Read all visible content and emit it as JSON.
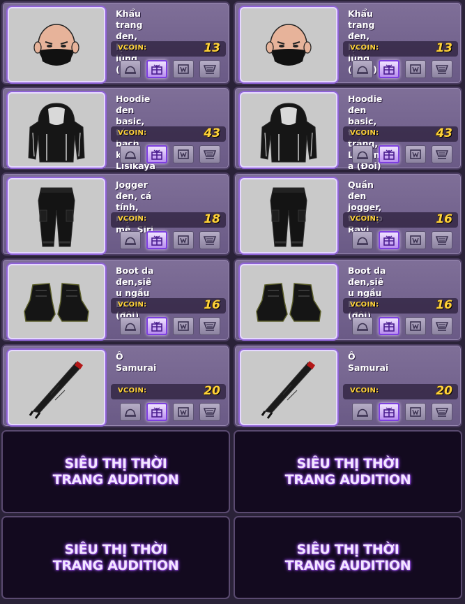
{
  "currency_label": "VCOIN:",
  "items": [
    {
      "name": "Khẩu trang đen, lạnh lùng (nữ)",
      "price": "13",
      "image": "mask-head-icon"
    },
    {
      "name": "Khẩu trang đen, lạnh lùng (nam)",
      "price": "13",
      "image": "mask-head-icon"
    },
    {
      "name": "Hoodie đen basic, tóc bạch kim Lisikaya (Đôi)",
      "price": "43",
      "image": "hoodie-icon"
    },
    {
      "name": "Hoodie đen basic, tóc trắng, Lisilanka (Đôi)",
      "price": "43",
      "image": "hoodie-icon"
    },
    {
      "name": "Jogger đen, cá tính, mạnh mẽ, Siri",
      "price": "18",
      "image": "jogger-pants-icon"
    },
    {
      "name": "Quần đen jogger, túi đắp Ravi",
      "price": "16",
      "image": "jogger-pants-icon"
    },
    {
      "name": "Boot da đen,siêu ngầu Brian (đôi)",
      "price": "16",
      "image": "boots-icon"
    },
    {
      "name": "Boot da đen,siêu ngầu Brian (đôi)",
      "price": "16",
      "image": "boots-icon"
    },
    {
      "name": "Ô Samurai",
      "price": "20",
      "image": "samurai-umbrella-icon"
    },
    {
      "name": "Ô Samurai",
      "price": "20",
      "image": "samurai-umbrella-icon"
    }
  ],
  "buttons": [
    "try-on-icon",
    "gift-icon",
    "wardrobe-icon",
    "cart-icon"
  ],
  "promo_lines": [
    "SIÊU THỊ THỜI TRANG AUDITION",
    "SIÊU THỊ THỜI TRANG AUDITION",
    "SIÊU THỊ THỜI TRANG AUDITION",
    "SIÊU THỊ THỜI TRANG AUDITION"
  ],
  "colors": {
    "price": "#ffd23a",
    "gift_highlight": "#7d3fe0",
    "card_bg": "#7f6f98",
    "promo_bg": "#130a1f"
  }
}
